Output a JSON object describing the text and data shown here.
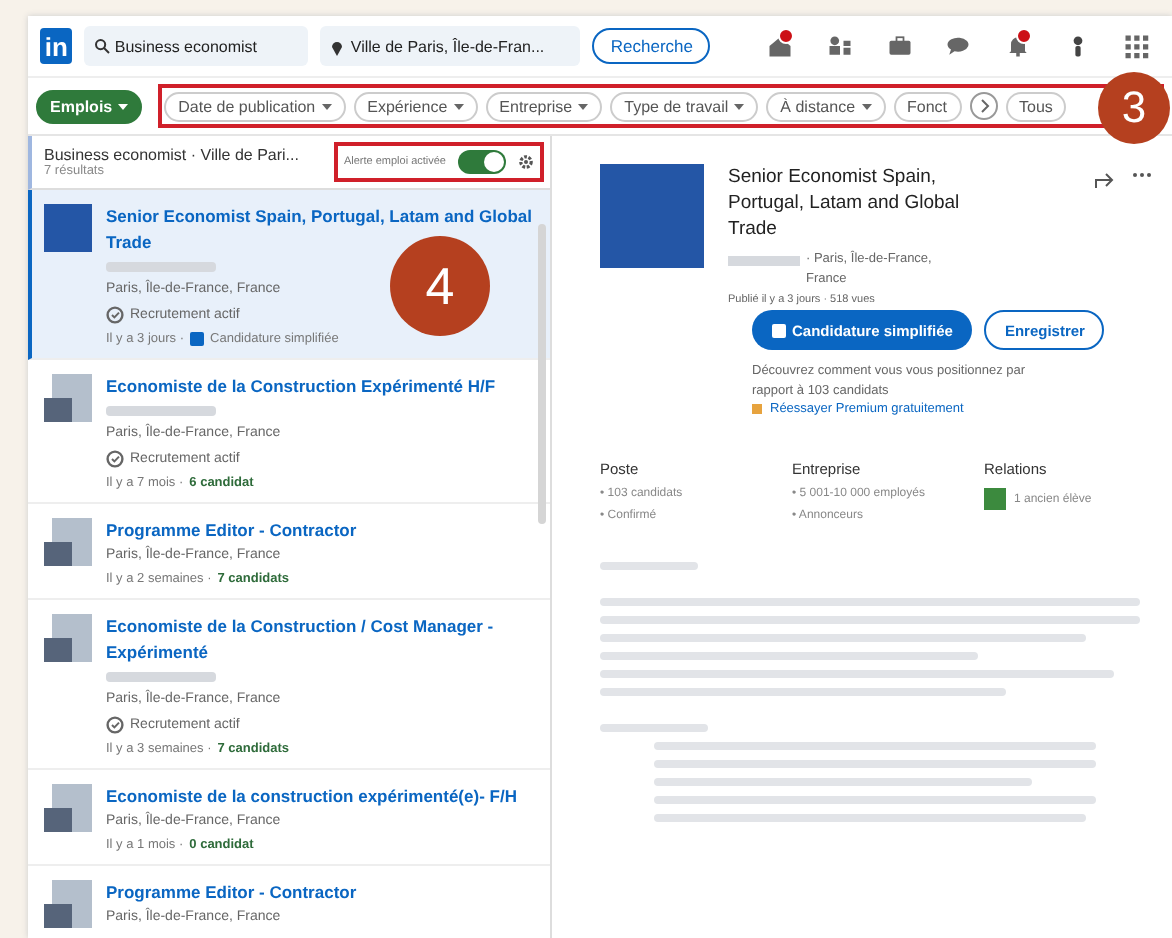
{
  "nav": {
    "logo": "in",
    "search_value": "Business economist",
    "location_value": "Ville de Paris, Île-de-Fran...",
    "search_button": "Recherche",
    "icons": [
      {
        "kind": "home",
        "badge": true
      },
      {
        "kind": "people",
        "badge": false
      },
      {
        "kind": "briefcase",
        "badge": false
      },
      {
        "kind": "message",
        "badge": false
      },
      {
        "kind": "bell",
        "badge": true
      },
      {
        "kind": "avatar",
        "badge": false
      },
      {
        "kind": "grid",
        "badge": false
      }
    ]
  },
  "filters": {
    "highlighted": true,
    "chips": [
      {
        "label": "Emplois",
        "selected": true
      },
      {
        "label": "Date de publication",
        "selected": false
      },
      {
        "label": "Expérience",
        "selected": false
      },
      {
        "label": "Entreprise",
        "selected": false
      },
      {
        "label": "Type de travail",
        "selected": false
      },
      {
        "label": "À distance",
        "selected": false
      },
      {
        "label": "Fonct",
        "selected": false
      },
      {
        "label": "Tous",
        "selected": false
      }
    ]
  },
  "results": {
    "title": "Business economist · Ville de Pari...",
    "count": "7 résultats",
    "alert": {
      "label": "Alerte emploi activée",
      "on": true,
      "highlighted": true
    }
  },
  "jobs": [
    {
      "title": "Senior Economist Spain, Portugal, Latam and Global Trade",
      "kind": "solid",
      "company_blurred": true,
      "location": "Paris, Île-de-France, France",
      "recruiting": "Recrutement actif",
      "meta": "Il y a 3 jours ·",
      "easy_apply": "Candidature simplifiée",
      "selected": true
    },
    {
      "title": "Economiste de la Construction Expérimenté H/F",
      "kind": "tiles",
      "company_blurred": true,
      "location": "Paris, Île-de-France, France",
      "recruiting": "Recrutement actif",
      "meta": "Il y a 7 mois ·",
      "applicants": "6 candidat",
      "selected": false
    },
    {
      "title": "Programme Editor - Contractor",
      "kind": "tiles",
      "company_blurred": false,
      "location": "Paris, Île-de-France, France",
      "meta": "Il y a 2 semaines ·",
      "applicants": "7 candidats",
      "selected": false
    },
    {
      "title": "Economiste de la Construction / Cost Manager - Expérimenté",
      "kind": "tiles",
      "company_blurred": true,
      "location": "Paris, Île-de-France, France",
      "recruiting": "Recrutement actif",
      "meta": "Il y a 3 semaines ·",
      "applicants": "7 candidats",
      "selected": false
    },
    {
      "title": "Economiste de la construction expérimenté(e)- F/H",
      "kind": "tiles",
      "company_blurred": false,
      "location": "Paris, Île-de-France, France",
      "meta": "Il y a 1 mois ·",
      "applicants": "0 candidat",
      "selected": false
    },
    {
      "title": "Programme Editor - Contractor",
      "kind": "tiles",
      "company_blurred": false,
      "location": "Paris, Île-de-France, France",
      "selected": false
    }
  ],
  "detail": {
    "title": "Senior Economist Spain, Portugal, Latam and Global Trade",
    "location": "· Paris, Île-de-France, France",
    "posted": "Publié il y a 3 jours · 518 vues",
    "apply_button": "Candidature simplifiée",
    "save_button": "Enregistrer",
    "insight": "Découvrez comment vous vous positionnez par rapport à 103 candidats",
    "premium_link": "Réessayer Premium gratuitement",
    "columns": [
      {
        "heading": "Poste",
        "items": [
          "• 103 candidats",
          "• Confirmé"
        ]
      },
      {
        "heading": "Entreprise",
        "items": [
          "• 5 001-10 000 employés",
          "• Annonceurs"
        ]
      },
      {
        "heading": "Relations",
        "relation": "1 ancien élève"
      }
    ]
  },
  "callouts": [
    {
      "label": "3"
    },
    {
      "label": "4"
    }
  ]
}
